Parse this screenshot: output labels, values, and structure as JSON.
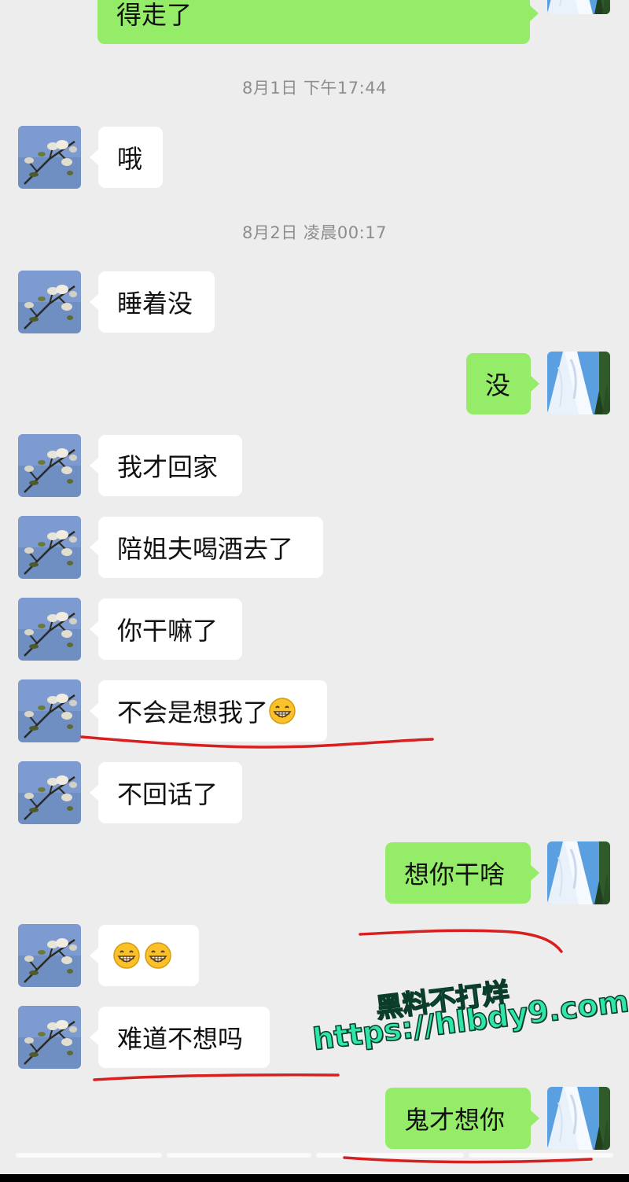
{
  "timestamps": {
    "ts1": "8月1日 下午17:44",
    "ts2": "8月2日 凌晨00:17"
  },
  "messages": {
    "m0": "得走了",
    "m1": "哦",
    "m2": "睡着没",
    "m3": "没",
    "m4": "我才回家",
    "m5": "陪姐夫喝酒去了",
    "m6": "你干嘛了",
    "m7": "不会是想我了",
    "m8": "不回话了",
    "m9": "想你干啥",
    "m11": "难道不想吗",
    "m12": "鬼才想你"
  },
  "watermark": {
    "line1": "黑料不打烊",
    "line2": "https://hlbdy9.com"
  },
  "colors": {
    "background": "#ededed",
    "incoming_bubble": "#ffffff",
    "outgoing_bubble": "#95ec69",
    "timestamp_text": "#8d8d8d",
    "annotation_underline": "#d81e1e",
    "watermark": "#2ee6a8"
  },
  "icons": {
    "contact_avatar": "flower-branch-avatar",
    "self_avatar": "sky-clouds-avatar",
    "emoji": "grinning-face-emoji"
  }
}
